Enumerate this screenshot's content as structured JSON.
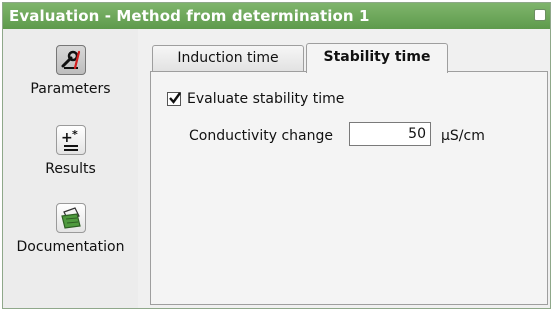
{
  "window": {
    "title": "Evaluation - Method from determination 1"
  },
  "sidebar": {
    "items": [
      {
        "label": "Parameters",
        "icon": "parameters-icon",
        "active": true
      },
      {
        "label": "Results",
        "icon": "results-icon",
        "active": false
      },
      {
        "label": "Documentation",
        "icon": "documentation-icon",
        "active": false
      }
    ]
  },
  "tabs": [
    {
      "label": "Induction time",
      "active": false
    },
    {
      "label": "Stability time",
      "active": true
    }
  ],
  "stability": {
    "checkbox_label": "Evaluate stability time",
    "checkbox_checked": true,
    "conductivity_label": "Conductivity change",
    "conductivity_value": "50",
    "conductivity_unit": "µS/cm"
  },
  "colors": {
    "titlebar": "#6aa757",
    "background": "#eeeeee"
  }
}
